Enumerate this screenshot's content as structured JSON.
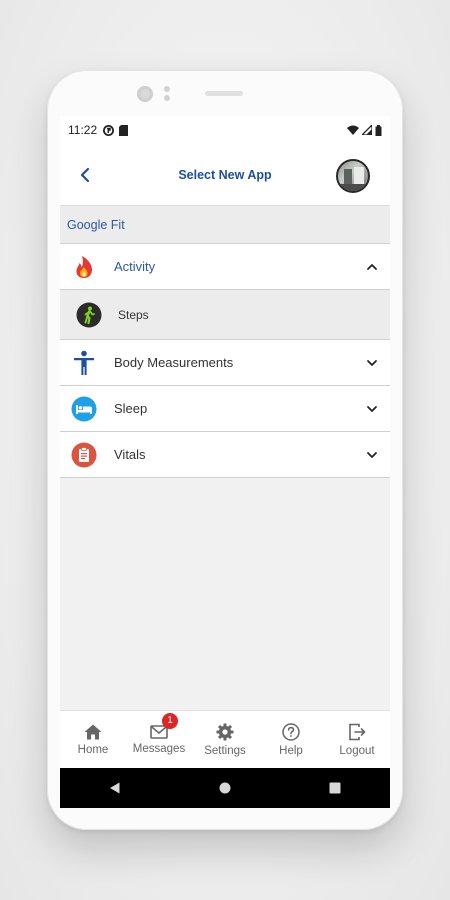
{
  "status_bar": {
    "time": "11:22"
  },
  "app_bar": {
    "title": "Select New App"
  },
  "section": {
    "title": "Google Fit"
  },
  "categories": [
    {
      "label": "Activity",
      "icon": "flame-icon",
      "expanded": true,
      "color": "#e53935"
    },
    {
      "label": "Body Measurements",
      "icon": "person-icon",
      "expanded": false,
      "color": "#1d4f9c"
    },
    {
      "label": "Sleep",
      "icon": "bed-icon",
      "expanded": false,
      "color": "#1ea0e6"
    },
    {
      "label": "Vitals",
      "icon": "clipboard-icon",
      "expanded": false,
      "color": "#d9553f"
    }
  ],
  "activity_items": [
    {
      "label": "Steps",
      "icon": "walking-icon",
      "color": "#7ed321"
    }
  ],
  "bottom_nav": [
    {
      "label": "Home",
      "icon": "home-icon"
    },
    {
      "label": "Messages",
      "icon": "mail-icon",
      "badge": "1"
    },
    {
      "label": "Settings",
      "icon": "gear-icon"
    },
    {
      "label": "Help",
      "icon": "help-icon"
    },
    {
      "label": "Logout",
      "icon": "logout-icon"
    }
  ],
  "colors": {
    "accent": "#1d4f9c",
    "badge": "#e02424"
  }
}
